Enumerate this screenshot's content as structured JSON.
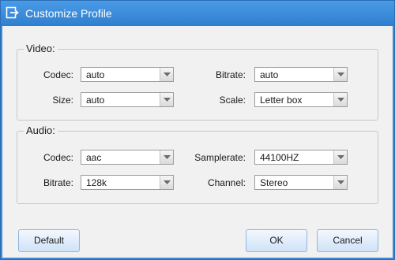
{
  "window": {
    "title": "Customize Profile"
  },
  "video": {
    "legend": "Video:",
    "codec": {
      "label": "Codec:",
      "value": "auto"
    },
    "bitrate": {
      "label": "Bitrate:",
      "value": "auto"
    },
    "size": {
      "label": "Size:",
      "value": "auto"
    },
    "scale": {
      "label": "Scale:",
      "value": "Letter box"
    }
  },
  "audio": {
    "legend": "Audio:",
    "codec": {
      "label": "Codec:",
      "value": "aac"
    },
    "samplerate": {
      "label": "Samplerate:",
      "value": "44100HZ"
    },
    "bitrate": {
      "label": "Bitrate:",
      "value": "128k"
    },
    "channel": {
      "label": "Channel:",
      "value": "Stereo"
    }
  },
  "buttons": {
    "default_label": "Default",
    "ok_label": "OK",
    "cancel_label": "Cancel"
  },
  "colors": {
    "titlebar": "#2f7fd0",
    "dialog_bg": "#f1f1f1",
    "button_border": "#8fb5e0"
  },
  "icons": {
    "title_icon": "export-icon",
    "dropdown_arrow": "chevron-down-icon"
  }
}
